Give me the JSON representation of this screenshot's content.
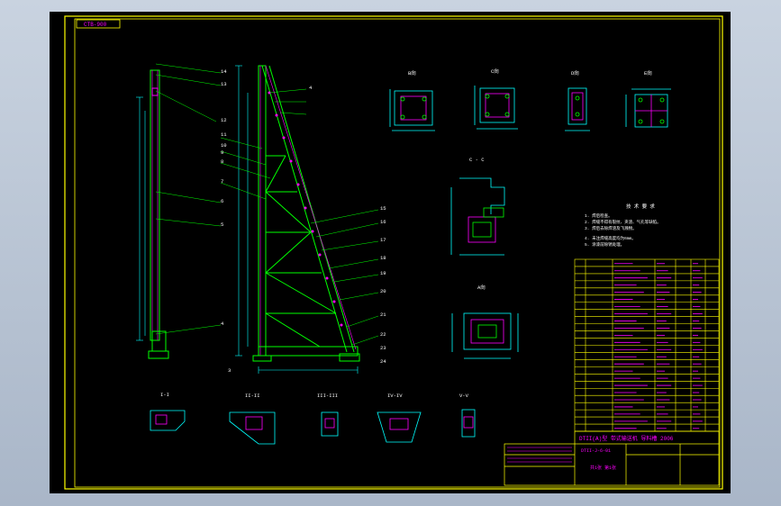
{
  "colors": {
    "background": "#000000",
    "frame": "#ffff00",
    "structure": "#00ff00",
    "dimension": "#00ffff",
    "leader": "#00ff00",
    "table": "#ffff00",
    "text_magenta": "#ff00ff",
    "text_white": "#ffffff",
    "hidden": "#ff4040"
  },
  "drawing": {
    "corner_tag": "CTB-900",
    "callouts_left": [
      "14",
      "13",
      "12",
      "11",
      "10",
      "9",
      "8",
      "7",
      "6",
      "5",
      "4",
      "3"
    ],
    "callouts_right": [
      "4",
      "15",
      "16",
      "17",
      "18",
      "19",
      "20",
      "21",
      "22",
      "23",
      "24"
    ],
    "section_marks_top": [
      "B向",
      "C向",
      "D向",
      "E向"
    ],
    "section_marks_bottom": [
      "I-I",
      "II-II",
      "III-III",
      "IV-IV",
      "V-V"
    ],
    "section_cc": "C - C",
    "section_a": "A向",
    "tech_title": "技 术 要 求",
    "tech_lines": [
      "1. 焊后检查。",
      "2. 焊缝不得有裂纹、夹渣、气孔等缺陷。",
      "3. 焊后去除焊渣及飞溅物。",
      "4. 未注焊缝高度均为6mm。",
      "5. 涂漆前除锈处理。"
    ],
    "title_block": {
      "main_title": "DTII(A)型 带式输送机 导料槽 2006",
      "drawing_no": "DTII-J-6-01",
      "sheet": "共1张 第1张"
    }
  }
}
